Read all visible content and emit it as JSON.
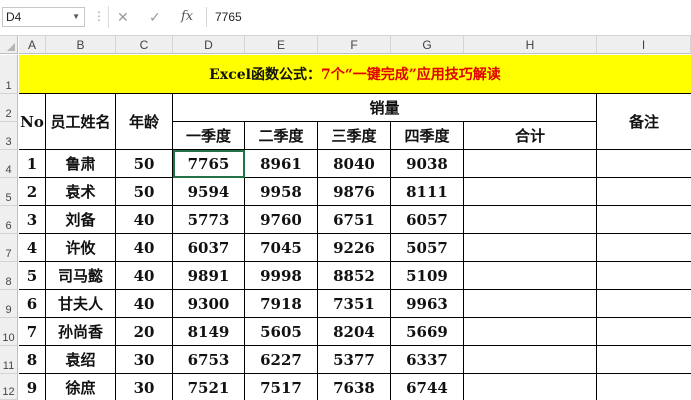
{
  "formula_bar": {
    "name_box": "D4",
    "cancel_glyph": "✕",
    "enter_glyph": "✓",
    "fx_label": "fx",
    "value": "7765"
  },
  "columns": [
    "A",
    "B",
    "C",
    "D",
    "E",
    "F",
    "G",
    "H",
    "I"
  ],
  "rows": [
    "1",
    "2",
    "3",
    "4",
    "5",
    "6",
    "7",
    "8",
    "9",
    "10",
    "11",
    "12"
  ],
  "title": {
    "part1": "Excel函数公式：",
    "part2": "7个“一键完成”应用技巧解读"
  },
  "headers": {
    "no": "No",
    "name": "员工姓名",
    "age": "年龄",
    "sales": "销量",
    "q1": "一季度",
    "q2": "二季度",
    "q3": "三季度",
    "q4": "四季度",
    "total": "合计",
    "remark": "备注"
  },
  "table": [
    {
      "no": "1",
      "name": "鲁肃",
      "age": "50",
      "q1": "7765",
      "q2": "8961",
      "q3": "8040",
      "q4": "9038"
    },
    {
      "no": "2",
      "name": "袁术",
      "age": "50",
      "q1": "9594",
      "q2": "9958",
      "q3": "9876",
      "q4": "8111"
    },
    {
      "no": "3",
      "name": "刘备",
      "age": "40",
      "q1": "5773",
      "q2": "9760",
      "q3": "6751",
      "q4": "6057"
    },
    {
      "no": "4",
      "name": "许攸",
      "age": "40",
      "q1": "6037",
      "q2": "7045",
      "q3": "9226",
      "q4": "5057"
    },
    {
      "no": "5",
      "name": "司马懿",
      "age": "40",
      "q1": "9891",
      "q2": "9998",
      "q3": "8852",
      "q4": "5109"
    },
    {
      "no": "6",
      "name": "甘夫人",
      "age": "40",
      "q1": "9300",
      "q2": "7918",
      "q3": "7351",
      "q4": "9963"
    },
    {
      "no": "7",
      "name": "孙尚香",
      "age": "20",
      "q1": "8149",
      "q2": "5605",
      "q3": "8204",
      "q4": "5669"
    },
    {
      "no": "8",
      "name": "袁绍",
      "age": "30",
      "q1": "6753",
      "q2": "6227",
      "q3": "5377",
      "q4": "6337"
    },
    {
      "no": "9",
      "name": "徐庶",
      "age": "30",
      "q1": "7521",
      "q2": "7517",
      "q3": "7638",
      "q4": "6744"
    }
  ]
}
